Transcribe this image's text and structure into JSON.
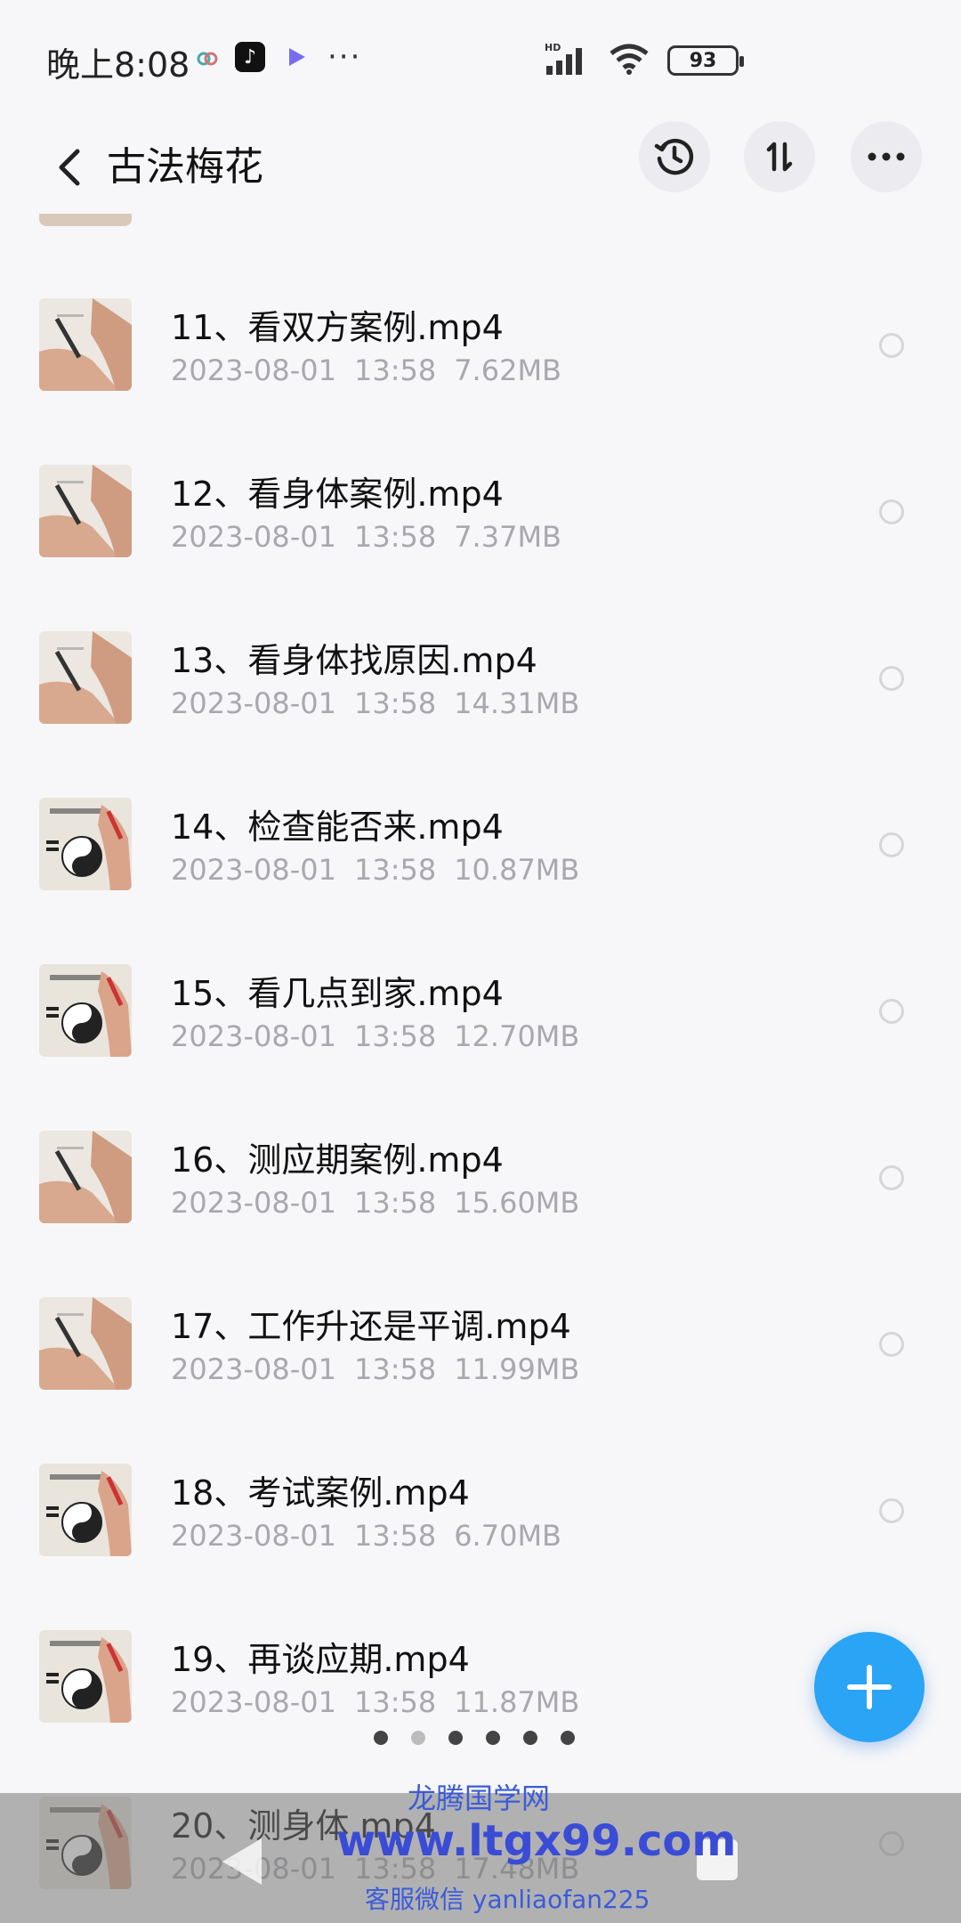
{
  "status_bar": {
    "time": "晚上8:08",
    "signal_label": "HD",
    "battery": "93",
    "more": "···"
  },
  "header": {
    "title": "古法梅花"
  },
  "files": [
    {
      "name": "11、看双方案例.mp4",
      "date": "2023-08-01",
      "time": "13:58",
      "size": "7.62MB",
      "thumb": "hand"
    },
    {
      "name": "12、看身体案例.mp4",
      "date": "2023-08-01",
      "time": "13:58",
      "size": "7.37MB",
      "thumb": "hand"
    },
    {
      "name": "13、看身体找原因.mp4",
      "date": "2023-08-01",
      "time": "13:58",
      "size": "14.31MB",
      "thumb": "hand"
    },
    {
      "name": "14、检查能否来.mp4",
      "date": "2023-08-01",
      "time": "13:58",
      "size": "10.87MB",
      "thumb": "bagua"
    },
    {
      "name": "15、看几点到家.mp4",
      "date": "2023-08-01",
      "time": "13:58",
      "size": "12.70MB",
      "thumb": "bagua"
    },
    {
      "name": "16、测应期案例.mp4",
      "date": "2023-08-01",
      "time": "13:58",
      "size": "15.60MB",
      "thumb": "hand"
    },
    {
      "name": "17、工作升还是平调.mp4",
      "date": "2023-08-01",
      "time": "13:58",
      "size": "11.99MB",
      "thumb": "hand"
    },
    {
      "name": "18、考试案例.mp4",
      "date": "2023-08-01",
      "time": "13:58",
      "size": "6.70MB",
      "thumb": "bagua"
    },
    {
      "name": "19、再谈应期.mp4",
      "date": "2023-08-01",
      "time": "13:58",
      "size": "11.87MB",
      "thumb": "bagua"
    },
    {
      "name": "20、测身体.mp4",
      "date": "2023-08-01",
      "time": "13:58",
      "size": "17.48MB",
      "thumb": "bagua"
    }
  ],
  "watermark": {
    "line1": "龙腾国学网",
    "line2": "www.ltgx99.com",
    "line3": "客服微信 yanliaofan225"
  },
  "colors": {
    "accent": "#2aa4f4",
    "meta_text": "#a8a8ae",
    "background": "#f7f7f9"
  }
}
